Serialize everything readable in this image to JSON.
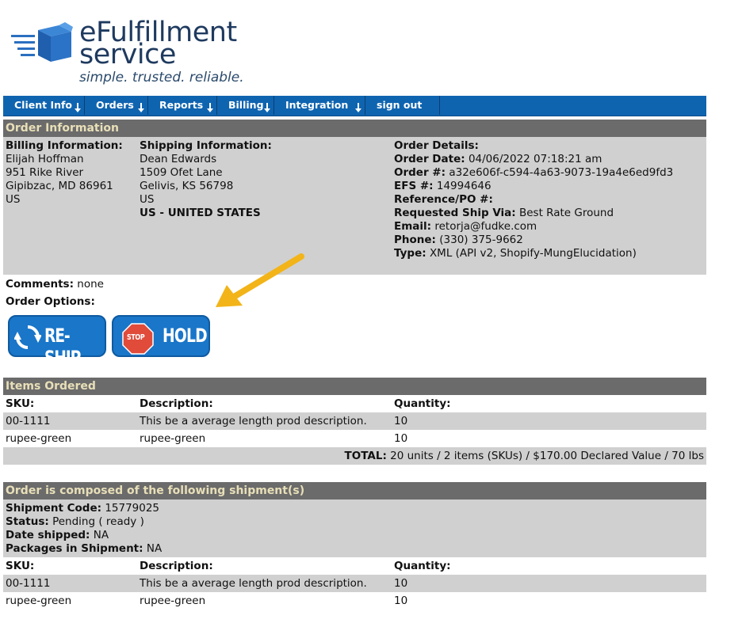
{
  "logo": {
    "line1": "eFulfillment",
    "line2": "service",
    "tagline": "simple. trusted. reliable."
  },
  "nav": {
    "items": [
      {
        "label": "Client Info"
      },
      {
        "label": "Orders"
      },
      {
        "label": "Reports"
      },
      {
        "label": "Billing"
      },
      {
        "label": "Integration"
      },
      {
        "label": "sign out"
      }
    ]
  },
  "order_info": {
    "title": "Order Information",
    "billing": {
      "heading": "Billing Information:",
      "name": "Elijah Hoffman",
      "street": "951 Rike River",
      "city": "Gipibzac, MD 86961",
      "country": "US"
    },
    "shipping": {
      "heading": "Shipping Information:",
      "name": "Dean Edwards",
      "street": "1509 Ofet Lane",
      "city": "Gelivis, KS 56798",
      "country": "US",
      "country_full": "US - UNITED STATES"
    },
    "details": {
      "heading": "Order Details:",
      "date_label": "Order Date:",
      "date_value": "04/06/2022 07:18:21 am",
      "order_label": "Order #:",
      "order_value": "a32e606f-c594-4a63-9073-19a4e6ed9fd3",
      "efs_label": "EFS #:",
      "efs_value": "14994646",
      "ref_label": "Reference/PO #:",
      "ref_value": "",
      "ship_via_label": "Requested Ship Via:",
      "ship_via_value": "Best Rate Ground",
      "email_label": "Email:",
      "email_value": "retorja@fudke.com",
      "phone_label": "Phone:",
      "phone_value": "(330) 375-9662",
      "type_label": "Type:",
      "type_value": "XML (API v2, Shopify-MungElucidation)"
    }
  },
  "comments": {
    "label": "Comments:",
    "value": "none"
  },
  "order_options": {
    "label": "Order Options:",
    "reship_label": "RE-SHIP",
    "hold_stop": "STOP",
    "hold_label": "HOLD"
  },
  "items": {
    "title": "Items Ordered",
    "headers": {
      "sku": "SKU:",
      "desc": "Description:",
      "qty": "Quantity:"
    },
    "rows": [
      {
        "sku": "00-1111",
        "desc": "This be a average length prod description.",
        "qty": "10"
      },
      {
        "sku": "rupee-green",
        "desc": "rupee-green",
        "qty": "10"
      }
    ],
    "total_label": "TOTAL:",
    "total_value": "20 units / 2 items (SKUs) / $170.00 Declared Value / 70 lbs"
  },
  "shipments": {
    "title": "Order is composed of the following shipment(s)",
    "code_label": "Shipment Code:",
    "code_value": "15779025",
    "status_label": "Status:",
    "status_value": "Pending ( ready )",
    "date_label": "Date shipped:",
    "date_value": "NA",
    "packages_label": "Packages in Shipment:",
    "packages_value": "NA",
    "headers": {
      "sku": "SKU:",
      "desc": "Description:",
      "qty": "Quantity:"
    },
    "rows": [
      {
        "sku": "00-1111",
        "desc": "This be a average length prod description.",
        "qty": "10"
      },
      {
        "sku": "rupee-green",
        "desc": "rupee-green",
        "qty": "10"
      }
    ]
  },
  "colors": {
    "nav_bg": "#0f64b0",
    "section_bar": "#6b6b6b",
    "section_text": "#e8dfb8",
    "panel_gray": "#d0d0d0",
    "reship_blue": "#1976c9",
    "stop_red": "#e04b3a",
    "arrow_yellow": "#f2b418"
  }
}
